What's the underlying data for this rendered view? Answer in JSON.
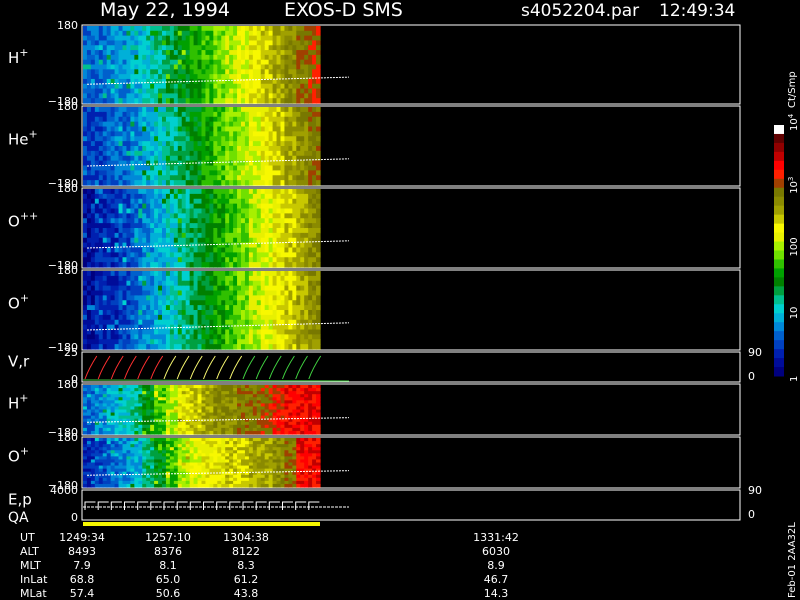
{
  "header": {
    "date": "May 22, 1994",
    "instrument": "EXOS-D SMS",
    "file": "s4052204.par",
    "time": "12:49:34"
  },
  "colorbar": {
    "unit_label": "Ct/Smp",
    "labels": [
      {
        "text": "1",
        "value": 1
      },
      {
        "text": "10",
        "value": 10
      },
      {
        "text": "100",
        "value": 100
      },
      {
        "text": "10",
        "sup": "3",
        "value": 1000
      },
      {
        "text": "10",
        "sup": "4",
        "value": 10000
      }
    ],
    "colors": [
      "#00007f",
      "#000c99",
      "#0020b0",
      "#0040c0",
      "#0060cc",
      "#0088d8",
      "#00b0d8",
      "#00d0d0",
      "#00c090",
      "#00a040",
      "#008000",
      "#00a000",
      "#30c000",
      "#70e000",
      "#a8f000",
      "#e8f000",
      "#f8f800",
      "#c8c800",
      "#a0a000",
      "#8a8a00",
      "#787800",
      "#a04000",
      "#ff2000",
      "#ff0000",
      "#c00000",
      "#900000",
      "#600000",
      "#ffffff"
    ]
  },
  "chart_data": {
    "type": "heatmap",
    "x_axis": {
      "ticks": [
        {
          "UT": "1249:34",
          "ALT": "8493",
          "MLT": "7.9",
          "InLat": "68.8",
          "MLat": "57.4"
        },
        {
          "UT": "1257:10",
          "ALT": "8376",
          "MLT": "8.1",
          "InLat": "65.0",
          "MLat": "50.6"
        },
        {
          "UT": "1304:38",
          "ALT": "8122",
          "MLT": "8.3",
          "InLat": "61.2",
          "MLat": "43.8"
        },
        {
          "UT": "1331:42",
          "ALT": "6030",
          "MLT": "8.9",
          "InLat": "46.7",
          "MLat": "14.3"
        }
      ],
      "row_labels": [
        "UT",
        "ALT",
        "MLT",
        "InLat",
        "MLat"
      ],
      "data_extent_fraction": 0.36
    },
    "panels": [
      {
        "label": "H",
        "sup": "+",
        "y_top": "180",
        "y_bottom": "−180",
        "intensity_profile": [
          4,
          4,
          5,
          5,
          6,
          7,
          8,
          9,
          10,
          11,
          12,
          13,
          14,
          15,
          16,
          17,
          18,
          19,
          20,
          21
        ]
      },
      {
        "label": "He",
        "sup": "+",
        "y_top": "180",
        "y_bottom": "−180",
        "intensity_profile": [
          3,
          3,
          4,
          4,
          5,
          6,
          7,
          8,
          9,
          10,
          11,
          12,
          13,
          14,
          15,
          16,
          17,
          18,
          19,
          20
        ]
      },
      {
        "label": "O",
        "sup": "++",
        "y_top": "180",
        "y_bottom": "−180",
        "intensity_profile": [
          1,
          2,
          2,
          3,
          4,
          5,
          6,
          7,
          8,
          9,
          10,
          11,
          12,
          13,
          14,
          15,
          16,
          17,
          18,
          19
        ]
      },
      {
        "label": "O",
        "sup": "+",
        "y_top": "180",
        "y_bottom": "−180",
        "intensity_profile": [
          1,
          2,
          2,
          3,
          4,
          5,
          6,
          7,
          8,
          9,
          10,
          11,
          12,
          13,
          14,
          15,
          16,
          17,
          18,
          19
        ]
      },
      {
        "label": "V,r",
        "sup": "",
        "y_top": "25",
        "y_bottom": "0",
        "right_top": "90",
        "right_bottom": "0",
        "line_plot": true
      },
      {
        "label": "H",
        "sup": "+",
        "y_top": "180",
        "y_bottom": "−180",
        "intensity_profile": [
          4,
          5,
          6,
          7,
          8,
          10,
          12,
          14,
          16,
          17,
          18,
          19,
          19,
          20,
          20,
          21,
          22,
          23,
          23,
          23
        ]
      },
      {
        "label": "O",
        "sup": "+",
        "y_top": "180",
        "y_bottom": "−180",
        "intensity_profile": [
          2,
          3,
          4,
          5,
          6,
          8,
          10,
          12,
          14,
          15,
          16,
          16,
          17,
          17,
          18,
          18,
          19,
          20,
          23,
          23
        ]
      },
      {
        "label": "E,p",
        "sup": "",
        "sub_label": "QA",
        "y_top": "4000",
        "y_bottom": "0",
        "right_top": "90",
        "right_bottom": "0",
        "step_plot": true
      }
    ]
  },
  "side_label": "Feb-01 2AA32L"
}
